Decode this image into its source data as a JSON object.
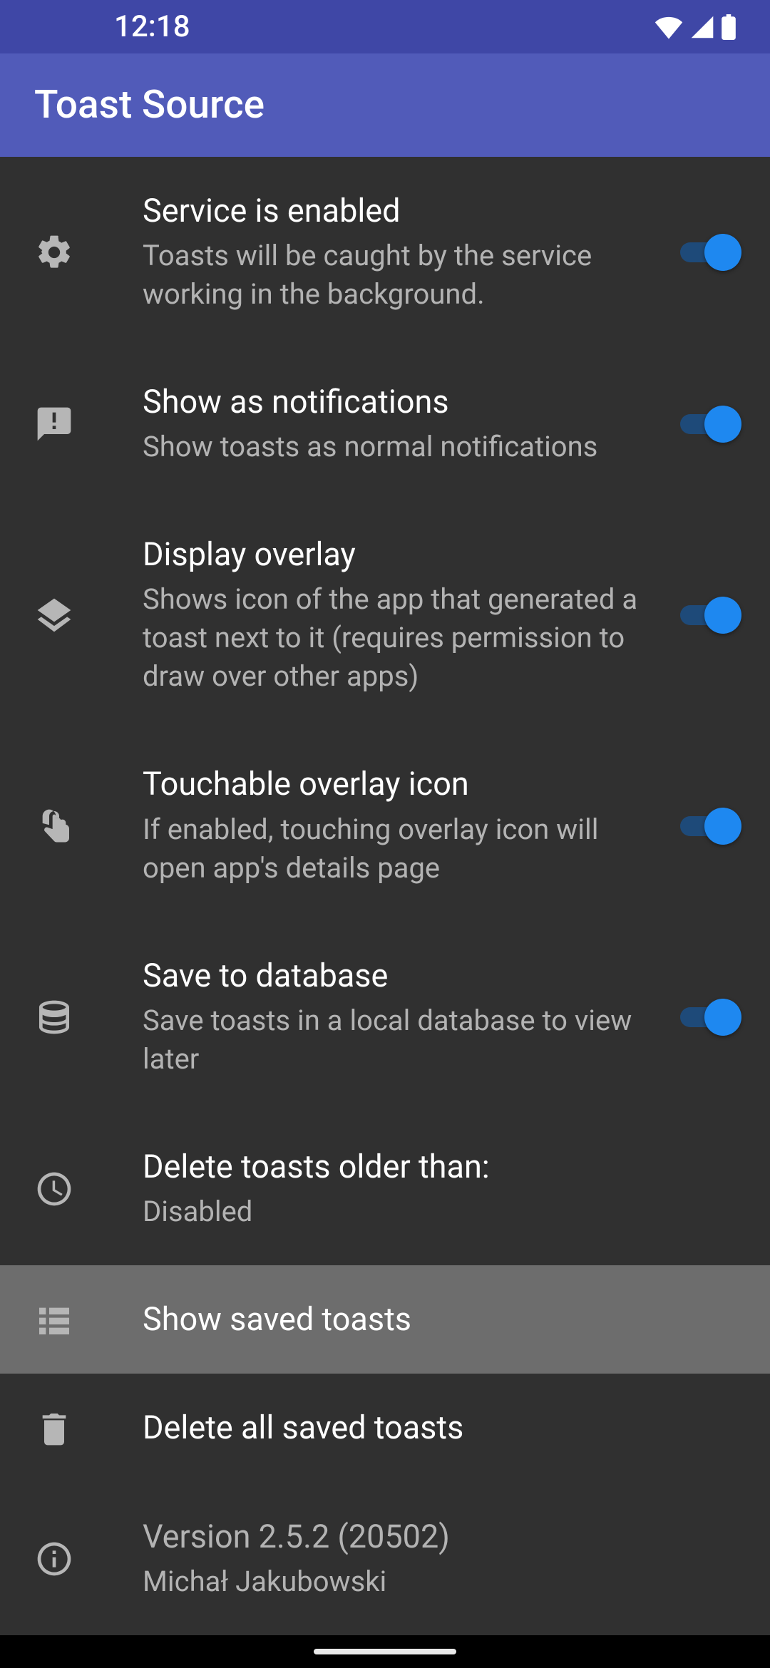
{
  "status": {
    "time": "12:18"
  },
  "app": {
    "title": "Toast Source"
  },
  "settings": [
    {
      "title": "Service is enabled",
      "subtitle": "Toasts will be caught by the service working in the background.",
      "switch": true
    },
    {
      "title": "Show as notifications",
      "subtitle": "Show toasts as normal notifications",
      "switch": true
    },
    {
      "title": "Display overlay",
      "subtitle": "Shows icon of the app that generated a toast next to it (requires permission to draw over other apps)",
      "switch": true
    },
    {
      "title": "Touchable overlay icon",
      "subtitle": "If enabled, touching overlay icon will open app's details page",
      "switch": true
    },
    {
      "title": "Save to database",
      "subtitle": "Save toasts in a local database to view later",
      "switch": true
    },
    {
      "title": "Delete toasts older than:",
      "subtitle": "Disabled"
    },
    {
      "title": "Show saved toasts"
    },
    {
      "title": "Delete all saved toasts"
    },
    {
      "title": "Version 2.5.2 (20502)",
      "subtitle": "Michał Jakubowski",
      "muted": true
    }
  ]
}
